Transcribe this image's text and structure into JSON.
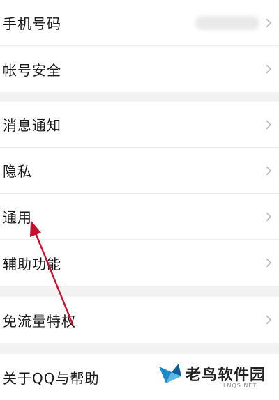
{
  "settings": {
    "group1": [
      {
        "label": "手机号码"
      },
      {
        "label": "帐号安全"
      }
    ],
    "group2": [
      {
        "label": "消息通知"
      },
      {
        "label": "隐私"
      },
      {
        "label": "通用"
      },
      {
        "label": "辅助功能"
      }
    ],
    "group3": [
      {
        "label": "免流量特权"
      }
    ],
    "group4": [
      {
        "label": "关于QQ与帮助"
      }
    ]
  },
  "watermark": {
    "title": "老鸟软件园",
    "subtitle": "LNQS.NET"
  },
  "colors": {
    "background": "#f2f2f2",
    "row_background": "#ffffff",
    "text": "#1a1a1a",
    "chevron": "#bdbdbd",
    "annotation_arrow": "#c8102e",
    "watermark_logo": "#1e88c8"
  },
  "icons": {
    "chevron": "chevron-right-icon",
    "annotation": "arrow-annotation",
    "logo": "bird-logo-icon"
  }
}
